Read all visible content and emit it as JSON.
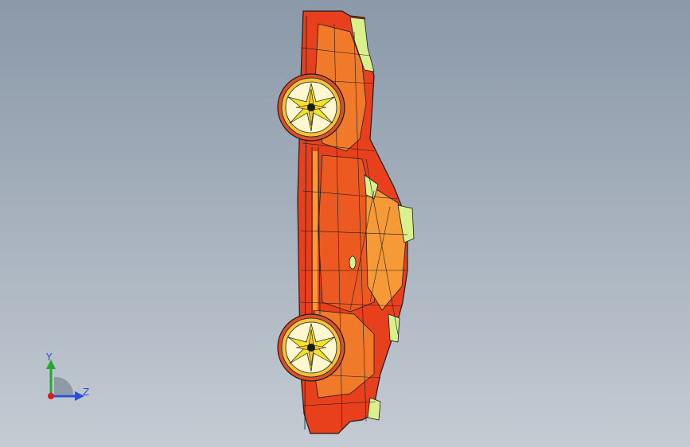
{
  "viewport": {
    "background_top": "#8a98a8",
    "background_bottom": "#c4cbd3"
  },
  "model": {
    "body_color": "#e8401c",
    "highlight_color": "#f07a2a",
    "edge_color": "#1b1b1b",
    "glass_color": "#d9f08c",
    "rim_color": "#f3e22a"
  },
  "triad": {
    "y_label": "Y",
    "z_label": "Z",
    "y_color": "#22a830",
    "z_color": "#2a4fd0",
    "origin_color": "#e01818"
  }
}
